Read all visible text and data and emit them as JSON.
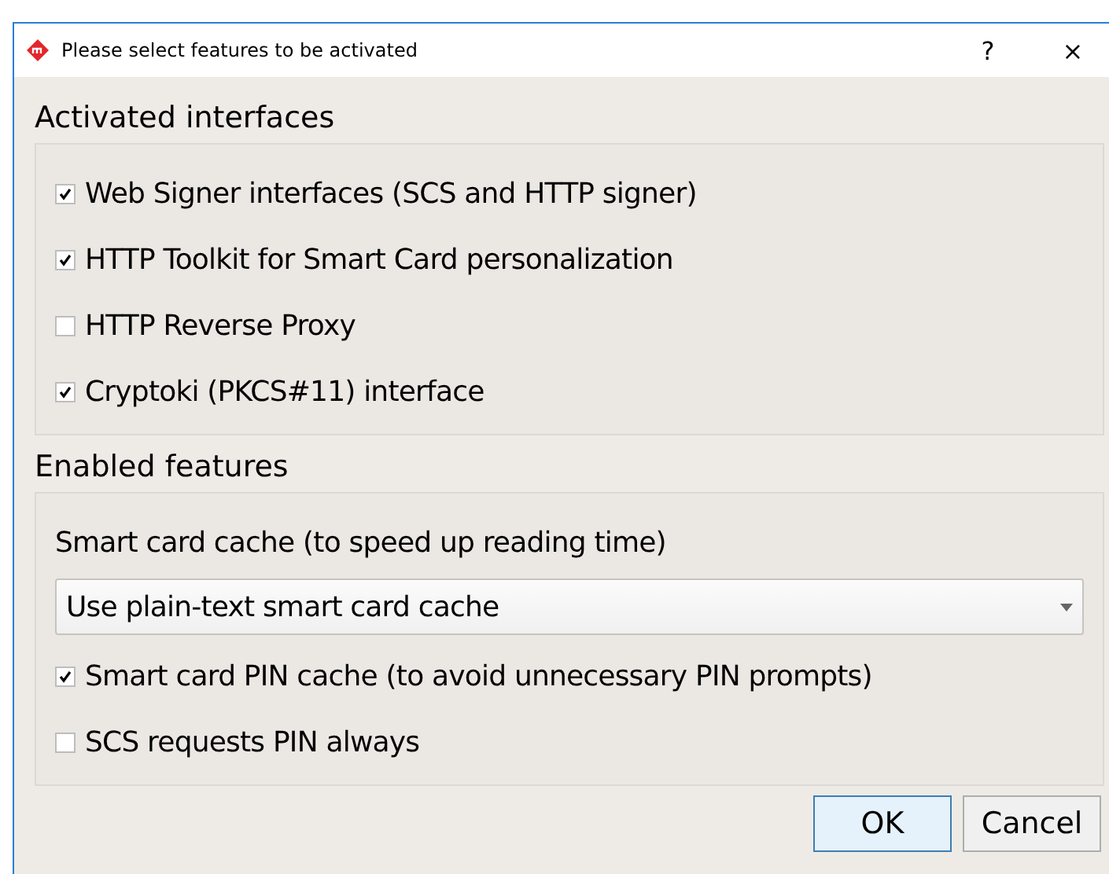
{
  "window": {
    "title": "Please select features to be activated",
    "help": "?",
    "close": "×"
  },
  "groups": [
    {
      "title": "Activated interfaces",
      "items": [
        {
          "kind": "checkbox",
          "label": "Web Signer interfaces (SCS and HTTP signer)",
          "checked": true
        },
        {
          "kind": "checkbox",
          "label": "HTTP Toolkit for Smart Card personalization",
          "checked": true
        },
        {
          "kind": "checkbox",
          "label": "HTTP Reverse Proxy",
          "checked": false
        },
        {
          "kind": "checkbox",
          "label": "Cryptoki (PKCS#11) interface",
          "checked": true
        }
      ]
    },
    {
      "title": "Enabled features",
      "items": [
        {
          "kind": "label",
          "label": "Smart card cache (to speed up reading time)"
        },
        {
          "kind": "combo",
          "value": "Use plain-text smart card cache"
        },
        {
          "kind": "checkbox",
          "label": "Smart card PIN cache (to avoid unnecessary PIN prompts)",
          "checked": true
        },
        {
          "kind": "checkbox",
          "label": "SCS requests PIN always",
          "checked": false
        }
      ]
    }
  ],
  "buttons": [
    {
      "label": "OK",
      "default": true
    },
    {
      "label": "Cancel",
      "default": false
    }
  ]
}
